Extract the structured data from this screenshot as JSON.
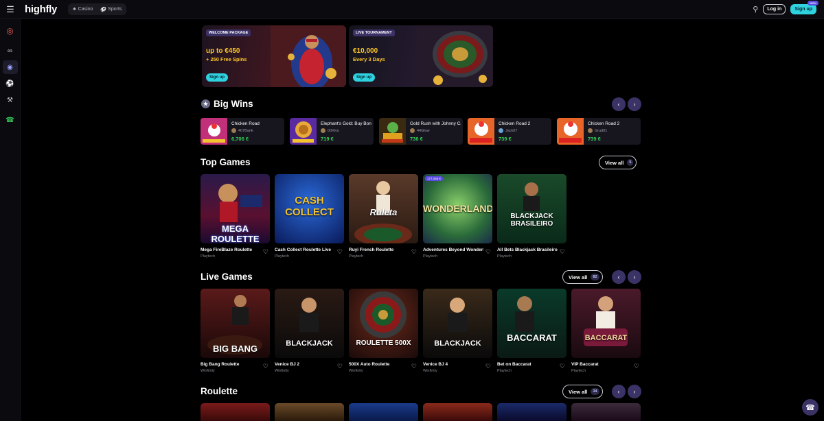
{
  "topbar": {
    "logo": "highfly",
    "nav": [
      {
        "label": "Casino"
      },
      {
        "label": "Sports"
      }
    ],
    "login": "Log in",
    "signup": "Sign up",
    "signup_badge": "100%"
  },
  "promos": [
    {
      "tag": "WELCOME PACKAGE",
      "headline": "up to €450",
      "subline": "+ 250 Free Spins",
      "cta": "Sign up"
    },
    {
      "tag": "LIVE TOURNAMENT",
      "headline": "€10,000",
      "subline": "Every 3 Days",
      "cta": "Sign up"
    }
  ],
  "big_wins": {
    "title": "Big Wins",
    "items": [
      {
        "game": "Chicken Road",
        "user": "407Bank",
        "amount": "6,706 €"
      },
      {
        "game": "Elephant's Gold: Buy Bonus",
        "user": "00Xivo",
        "amount": "719 €"
      },
      {
        "game": "Gold Rush with Johnny Cash",
        "user": "44Glow",
        "amount": "736 €"
      },
      {
        "game": "Chicken Road 2",
        "user": "Jack07",
        "amount": "739 €"
      },
      {
        "game": "Chicken Road 2",
        "user": "Grud01",
        "amount": "739 €"
      }
    ]
  },
  "top_games": {
    "title": "Top Games",
    "view_all": "View all",
    "count": "5",
    "items": [
      {
        "name": "Mega FireBlaze Roulette",
        "provider": "Playtech",
        "art": "MEGA ROULETTE"
      },
      {
        "name": "Cash Collect Roulette Live",
        "provider": "Playtech",
        "art": "CASH COLLECT"
      },
      {
        "name": "Ruyi French Roulette",
        "provider": "Playtech",
        "art": "Ruleta"
      },
      {
        "name": "Adventures Beyond Wonderland",
        "provider": "Playtech",
        "art": "WONDERLAND",
        "jackpot": "177,446 €"
      },
      {
        "name": "All Bets Blackjack Brasileiro",
        "provider": "Playtech",
        "art": "BLACKJACK BRASILEIRO"
      }
    ]
  },
  "live_games": {
    "title": "Live Games",
    "view_all": "View all",
    "count": "82",
    "items": [
      {
        "name": "Big Bang Roulette",
        "provider": "Winfinity",
        "art": "BIG BANG"
      },
      {
        "name": "Venice BJ 2",
        "provider": "Winfinity",
        "art": "BLACKJACK"
      },
      {
        "name": "500X Auto Roulette",
        "provider": "Winfinity",
        "art": "ROULETTE 500X"
      },
      {
        "name": "Venice BJ 4",
        "provider": "Winfinity",
        "art": "BLACKJACK"
      },
      {
        "name": "Bet on Baccarat",
        "provider": "Playtech",
        "art": "BACCARAT"
      },
      {
        "name": "VIP Baccarat",
        "provider": "Playtech",
        "art": "BACCARAT"
      }
    ]
  },
  "roulette": {
    "title": "Roulette",
    "view_all": "View all",
    "count": "34"
  }
}
